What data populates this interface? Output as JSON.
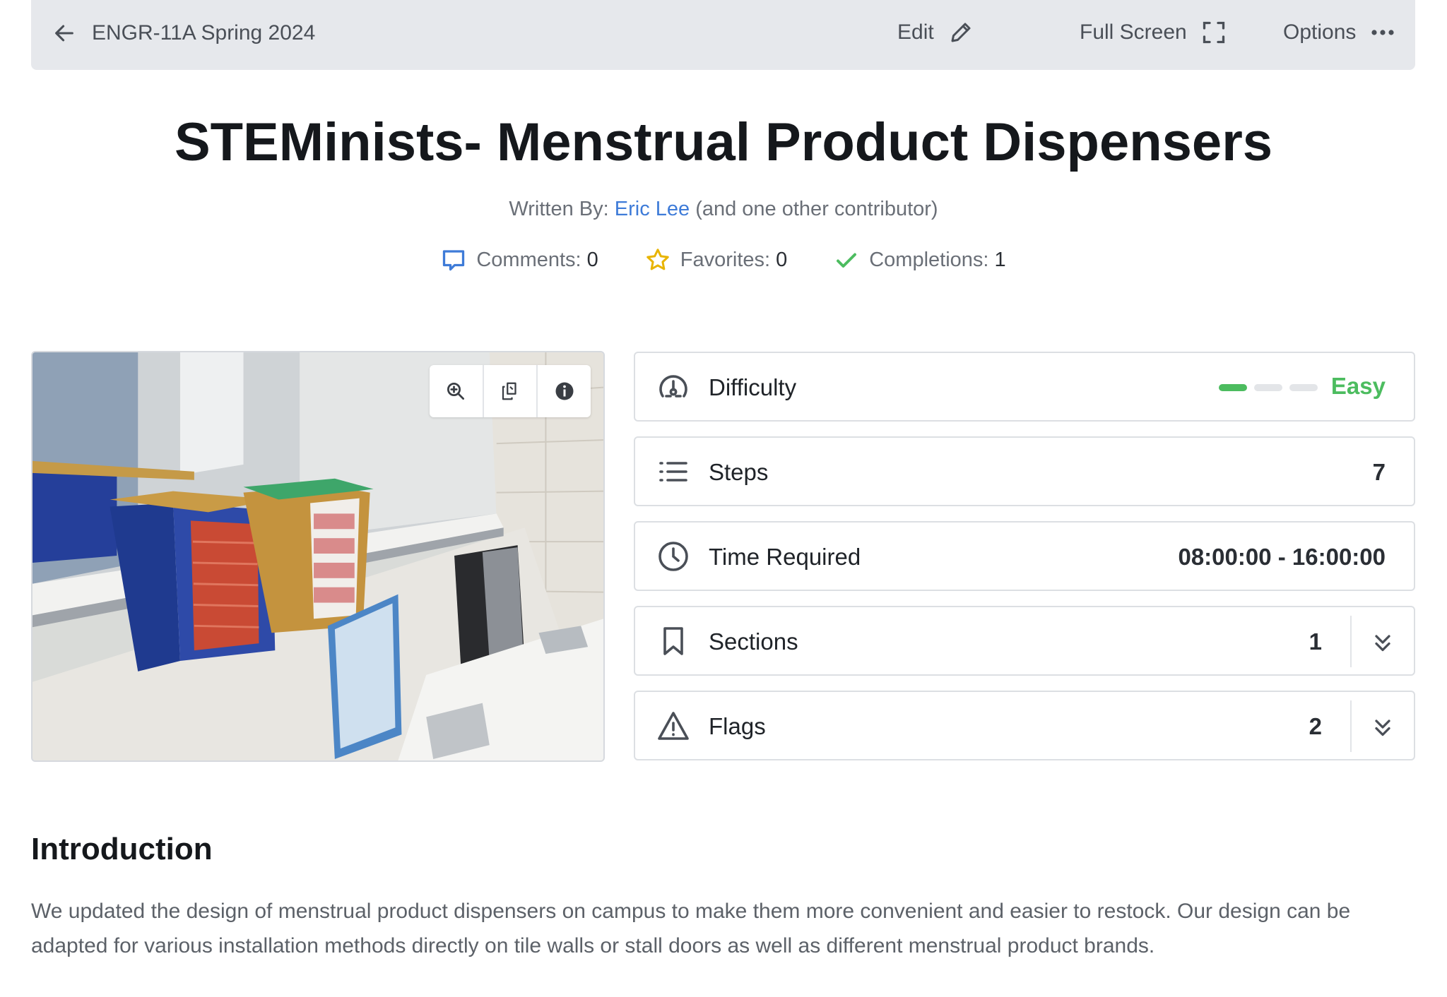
{
  "topbar": {
    "back_label": "ENGR-11A Spring 2024",
    "edit_label": "Edit",
    "fullscreen_label": "Full Screen",
    "options_label": "Options"
  },
  "guide": {
    "title": "STEMinists- Menstrual Product Dispensers",
    "written_by_label": "Written By:",
    "author": "Eric Lee",
    "contributors_note": "(and one other contributor)"
  },
  "stats": {
    "comments_label": "Comments:",
    "comments": "0",
    "favorites_label": "Favorites:",
    "favorites": "0",
    "completions_label": "Completions:",
    "completions": "1"
  },
  "details": {
    "difficulty_label": "Difficulty",
    "difficulty_value": "Easy",
    "difficulty_level": 1,
    "difficulty_max": 3,
    "steps_label": "Steps",
    "steps_value": "7",
    "time_label": "Time Required",
    "time_value": "08:00:00 - 16:00:00",
    "sections_label": "Sections",
    "sections_value": "1",
    "flags_label": "Flags",
    "flags_value": "2"
  },
  "introduction": {
    "heading": "Introduction",
    "text": "We updated the design of menstrual product dispensers on campus to make them more convenient and easier to restock. Our design can be adapted for various installation methods directly on tile walls or stall doors as well as different menstrual product brands."
  },
  "colors": {
    "accent_link": "#3e7bd8",
    "easy_green": "#4cbc5f",
    "star": "#e8b400",
    "check": "#4cbc5f"
  }
}
